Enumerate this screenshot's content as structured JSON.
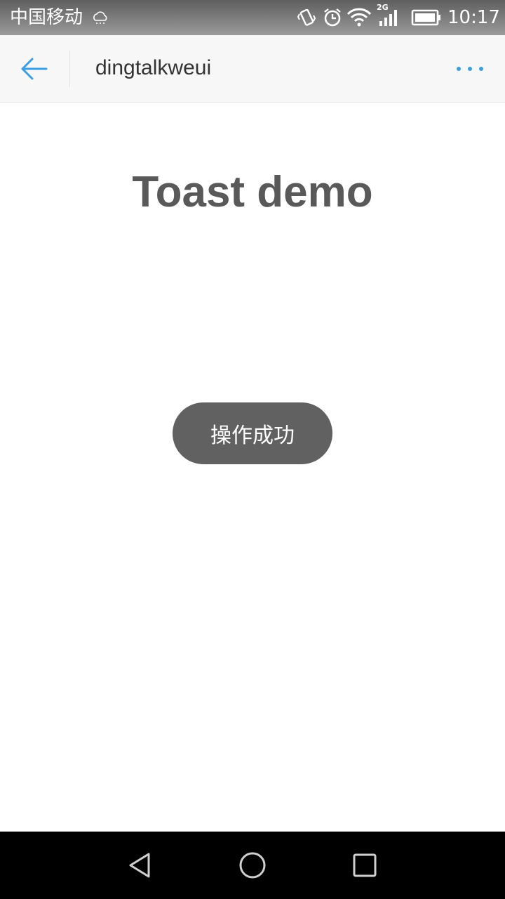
{
  "status_bar": {
    "carrier": "中国移动",
    "network_type": "2G",
    "time": "10:17",
    "icons": [
      "weather-cloud-icon",
      "vibrate-icon",
      "alarm-icon",
      "wifi-icon",
      "signal-icon",
      "battery-icon"
    ]
  },
  "nav_bar": {
    "title": "dingtalkweui",
    "back_icon": "arrow-left-icon",
    "more_icon": "more-horizontal-icon",
    "accent_color": "#3a9fe3"
  },
  "main": {
    "title": "Toast demo"
  },
  "toast": {
    "message": "操作成功"
  },
  "system_nav": {
    "icons": [
      "back-triangle-icon",
      "home-circle-icon",
      "recent-square-icon"
    ]
  }
}
